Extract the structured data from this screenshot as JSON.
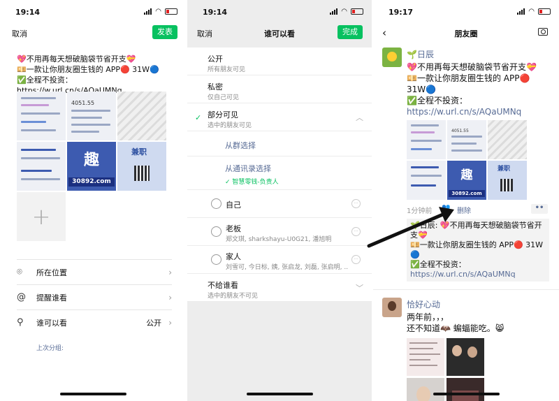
{
  "status": {
    "p1_time": "19:14",
    "p2_time": "19:14",
    "p3_time": "19:17"
  },
  "p1": {
    "cancel": "取消",
    "publish": "发表",
    "post_lines": [
      "💖不用再每天想破脑袋节省开支💝",
      "💴一款让你朋友圈生钱的 APP🔴 31W🔵",
      "✅全程不投资：https://w.url.cn/s/AQaUMNq"
    ],
    "thumb_numbers": [
      "4051.55"
    ],
    "thumb_big": "趣",
    "thumb_url": "30892.com",
    "thumb_title2": "兼职",
    "options": [
      {
        "icon": "⌾",
        "label": "所在位置",
        "value": ""
      },
      {
        "icon": "@",
        "label": "提醒谁看",
        "value": ""
      },
      {
        "icon": "⚲",
        "label": "谁可以看",
        "value": "公开"
      }
    ],
    "last_group": "上次分组:"
  },
  "p2": {
    "cancel": "取消",
    "title": "谁可以看",
    "done": "完成",
    "public_title": "公开",
    "public_sub": "所有朋友可见",
    "private_title": "私密",
    "private_sub": "仅自己可见",
    "partial_title": "部分可见",
    "partial_sub": "选中的朋友可见",
    "from_group": "从群选择",
    "from_contacts": "从通讯录选择",
    "contacts_tag": "✓ 智慧零钱-负责人",
    "tags": [
      {
        "name": "自己",
        "members": ""
      },
      {
        "name": "老板",
        "members": "郑文琪, sharkshayu-U0G21, 潘旭明"
      },
      {
        "name": "家人",
        "members": "刘雪可, 今日标, 姨, 张启龙, 刘磊, 张启明, ..."
      }
    ],
    "exclude_title": "不给谁看",
    "exclude_sub": "选中的朋友不可见"
  },
  "p3": {
    "title": "朋友圈",
    "post1": {
      "name": "🌱日辰",
      "lines": [
        "💖不用再每天想破脑袋节省开支💝",
        "💴一款让你朋友圈生钱的 APP🔴",
        "31W🔵",
        "✅全程不投资："
      ],
      "link": "https://w.url.cn/s/AQaUMNq",
      "time": "1分钟前",
      "delete": "删除",
      "more": "••",
      "comment_lines": [
        "🌱日辰: 💖不用再每天想破脑袋节省开",
        "支💝",
        "💴一款让你朋友圈生钱的 APP🔴 31W",
        "🔵",
        "✅全程不投资："
      ],
      "comment_link": "https://w.url.cn/s/AQaUMNq"
    },
    "post2": {
      "name": "恰好心动",
      "lines": [
        "两年前，，，",
        "还不知道🦇 蝙蝠能吃。😸"
      ]
    }
  }
}
